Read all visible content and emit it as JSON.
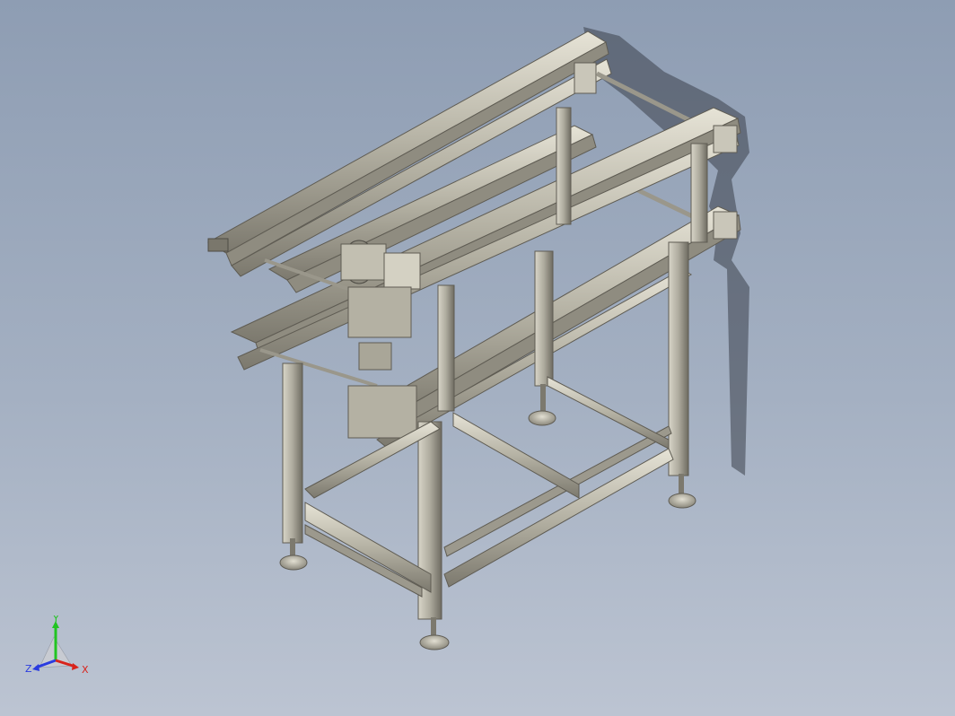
{
  "app": {
    "view": "isometric-3d-cad-viewport",
    "background_top": "#8e9db3",
    "background_bottom": "#bcc4d2"
  },
  "model": {
    "name_icon": "dual-lane-conveyor-frame-icon",
    "profile_color": "#b9b6a8",
    "profile_dark": "#6f6c62",
    "shadow_color": "#3a3f4a"
  },
  "triad": {
    "y_label": "Y",
    "z_label": "Z",
    "x_label": "X",
    "y_color": "#22c422",
    "z_color": "#2a3ce0",
    "x_color": "#d8241c"
  }
}
